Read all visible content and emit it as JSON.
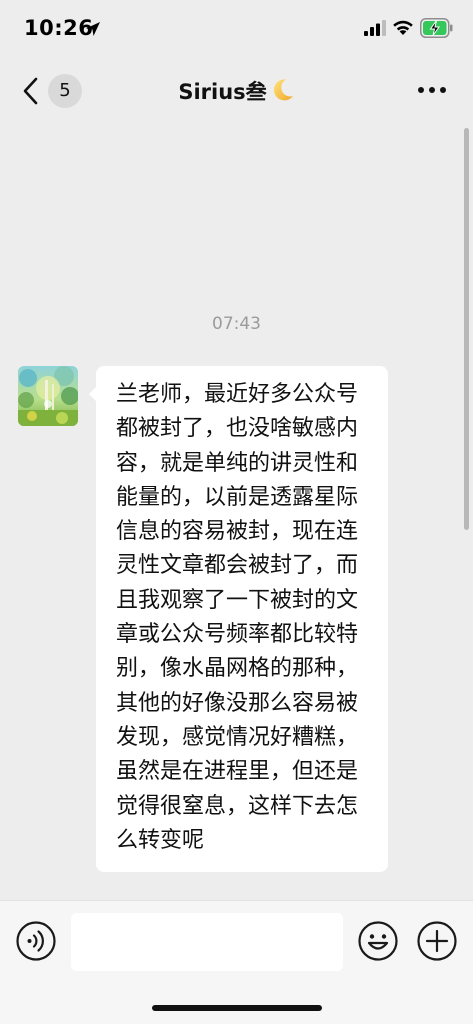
{
  "status_bar": {
    "time": "10:26",
    "battery_state": "charging",
    "battery_color": "#34c759"
  },
  "nav": {
    "unread_count": "5",
    "title": "Sirius叁"
  },
  "chat": {
    "timestamp": "07:43",
    "messages": [
      {
        "sender": "other",
        "text": "兰老师，最近好多公众号都被封了，也没啥敏感内容，就是单纯的讲灵性和能量的，以前是透露星际信息的容易被封，现在连灵性文章都会被封了，而且我观察了一下被封的文章或公众号频率都比较特别，像水晶网格的那种，其他的好像没那么容易被发现，感觉情况好糟糕，虽然是在进程里，但还是觉得很窒息，这样下去怎么转变呢"
      }
    ]
  },
  "input_bar": {
    "message_value": ""
  },
  "colors": {
    "background": "#ededed",
    "bubble": "#ffffff",
    "timestamp": "#9b9b9b"
  }
}
